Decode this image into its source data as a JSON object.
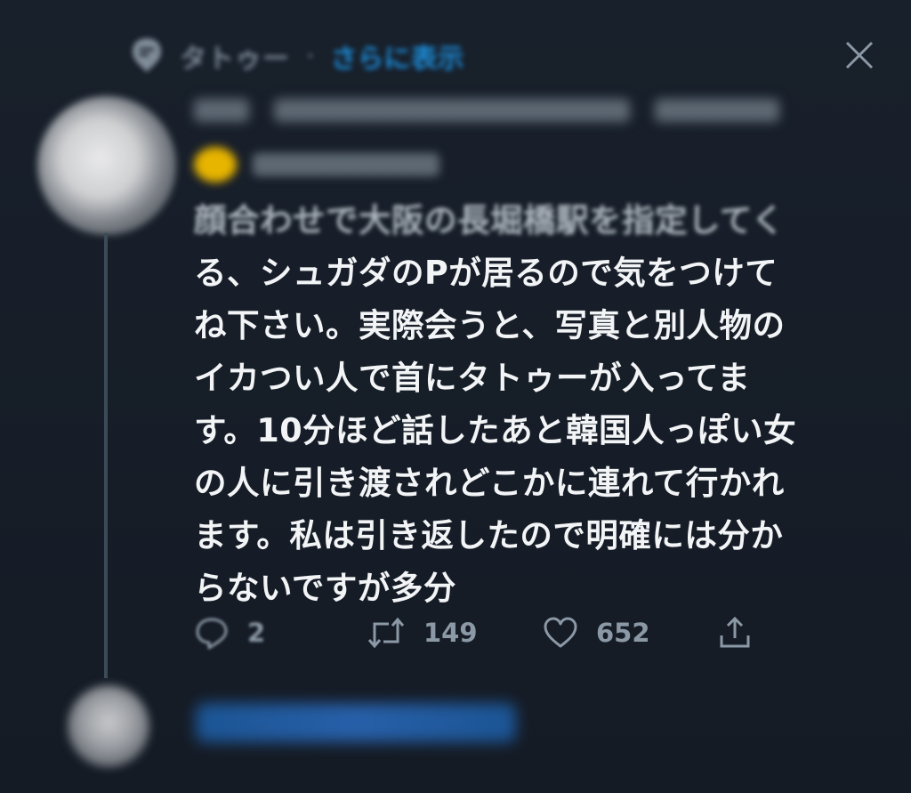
{
  "header": {
    "context_label": "タトゥー",
    "separator": "·",
    "context_link": "さらに表示"
  },
  "tweet": {
    "text_faded": "顔合わせで大阪の長堀橋駅を指定してく",
    "text_lines": [
      "る、シュガダのPが居るので気をつけて",
      "ね下さい。実際会うと、写真と別人物の",
      "イカつい人で首にタトゥーが入ってま",
      "す。10分ほど話したあと韓国人っぽい女",
      "の人に引き渡されどこかに連れて行かれ",
      "ます。私は引き返したので明確には分か",
      "らないですが多分"
    ]
  },
  "actions": {
    "reply_count": "2",
    "retweet_count": "149",
    "like_count": "652"
  },
  "icons": {
    "context": "comment-bubble-icon",
    "close": "close-icon",
    "reply": "reply-icon",
    "retweet": "retweet-icon",
    "like": "heart-icon",
    "share": "share-icon"
  },
  "colors": {
    "background": "#151b25",
    "text": "#f2f4f6",
    "muted": "#8b98a5",
    "accent": "#1d9bf0"
  }
}
